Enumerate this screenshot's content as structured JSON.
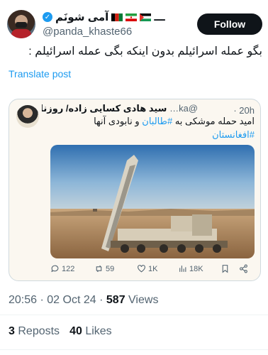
{
  "author": {
    "display_name": "آمی شونَم",
    "handle": "@panda_khaste66",
    "name_decoration": "ـــ",
    "flags": [
      "afghanistan-flag-icon",
      "iran-flag-icon",
      "palestine-flag-icon"
    ]
  },
  "follow_label": "Follow",
  "tweet": {
    "text": "بگو عمله اسرائیلم بدون اینکه بگی عمله اسرائیلم :",
    "translate_label": "Translate post"
  },
  "quote": {
    "author_name": "سید هادی کسایی زاده/ روزنامه نگار",
    "handle": "@ka…",
    "time": "· 20h",
    "text_prefix": "امید حمله موشکی به ",
    "hashtag_taliban": "#طالبان",
    "text_suffix": " و نابودی آنها",
    "hashtag_afghanistan": "#افغانستان",
    "actions": {
      "replies": "122",
      "reposts": "59",
      "likes": "1K",
      "views": "18K"
    }
  },
  "meta": {
    "time": "20:56",
    "date": "02 Oct 24",
    "views_count": "587",
    "views_label": "Views"
  },
  "stats": {
    "reposts_count": "3",
    "reposts_label": "Reposts",
    "likes_count": "40",
    "likes_label": "Likes"
  },
  "colors": {
    "accent": "#1d9bf0",
    "text": "#0f1419",
    "muted": "#536471",
    "follow_bg": "#0f1419"
  }
}
